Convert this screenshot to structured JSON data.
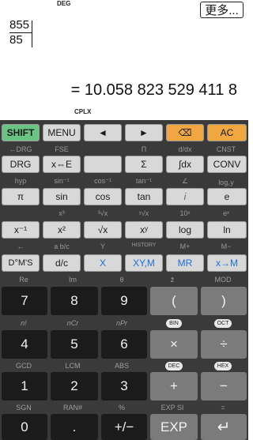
{
  "display": {
    "angle_mode": "DEG",
    "more_button": "更多...",
    "numerator": "855",
    "denominator": "85",
    "result": "= 10.058 823 529 411 8",
    "complex_mode": "CPLX"
  },
  "keys": {
    "row1": [
      "SHIFT",
      "MENU",
      "◄",
      "►",
      "⌫",
      "AC"
    ],
    "row1_colors": {
      "shift": "#69c483",
      "ac": "#f0a742",
      "backspace": "#f0a742"
    },
    "row2_labels": [
      "←DRG",
      "FSE",
      "",
      "Π",
      "d/dx",
      "CNST"
    ],
    "row2": [
      "DRG",
      "x⇔E",
      "",
      "Σ",
      "∫dx",
      "CONV"
    ],
    "row3_labels": [
      "hyp",
      "sin⁻¹",
      "cos⁻¹",
      "tan⁻¹",
      "∠",
      "log꜀y"
    ],
    "row3": [
      "π",
      "sin",
      "cos",
      "tan",
      "i",
      "e"
    ],
    "row4_labels": [
      "",
      "x³",
      "³√x",
      "ʸ√x",
      "10ˣ",
      "eˣ"
    ],
    "row4": [
      "x⁻¹",
      "x²",
      "√x",
      "xʸ",
      "log",
      "ln"
    ],
    "row5_labels": [
      "←",
      "a b/c",
      "Y",
      "HISTORY",
      "M+",
      "M−"
    ],
    "row5": [
      "D°M'S",
      "d/c",
      "X",
      "XY,M",
      "MR",
      "x→M"
    ],
    "row6_labels": [
      "Re",
      "Im",
      "θ",
      "z̄",
      "",
      "MOD"
    ],
    "row6": [
      "7",
      "8",
      "9",
      "(",
      ")"
    ],
    "row7_labels": [
      "n!",
      "nCr",
      "nPr",
      "BIN",
      "OCT"
    ],
    "row7": [
      "4",
      "5",
      "6",
      "×",
      "÷"
    ],
    "row8_labels": [
      "GCD",
      "LCM",
      "ABS",
      "DEC",
      "HEX"
    ],
    "row8": [
      "1",
      "2",
      "3",
      "+",
      "−"
    ],
    "row9_labels": [
      "SGN",
      "RAN#",
      "%",
      "EXP SI",
      "="
    ],
    "row9": [
      "0",
      ".",
      "+/−",
      "EXP",
      "↵"
    ]
  }
}
